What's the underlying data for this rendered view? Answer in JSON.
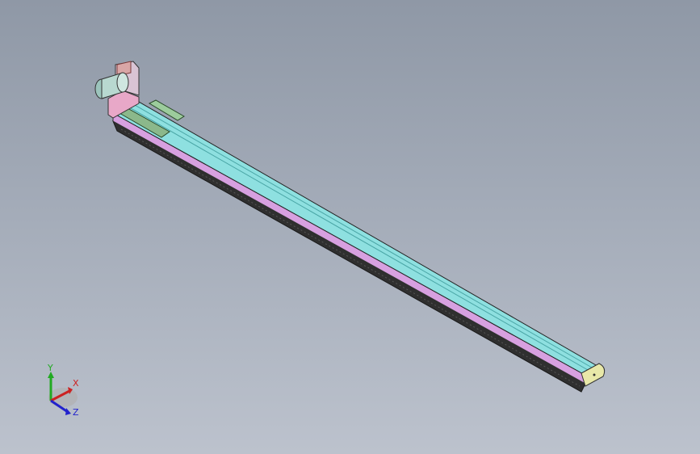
{
  "viewport": {
    "background_top": "#8f98a6",
    "background_bottom": "#bcc2cd"
  },
  "model": {
    "parts": [
      "motor-body",
      "motor-flange",
      "coupling-housing",
      "end-cap-motor-side",
      "carriage-slider",
      "rail-top-cover",
      "rail-side-profile",
      "rail-base",
      "end-cap-far"
    ],
    "colors": {
      "motor": "#b8d8d0",
      "motor_flange": "#d9a6a6",
      "housing_pink": "#e8a8c8",
      "top_cover": "#8ee0e0",
      "side_profile": "#d7a0e0",
      "base_dark": "#2e2e2e",
      "carriage": "#8bb88b",
      "end_cap": "#e8e8a8"
    }
  },
  "triad": {
    "x_label": "X",
    "y_label": "Y",
    "z_label": "Z",
    "x_color": "#cc2222",
    "y_color": "#22aa22",
    "z_color": "#2222cc"
  }
}
